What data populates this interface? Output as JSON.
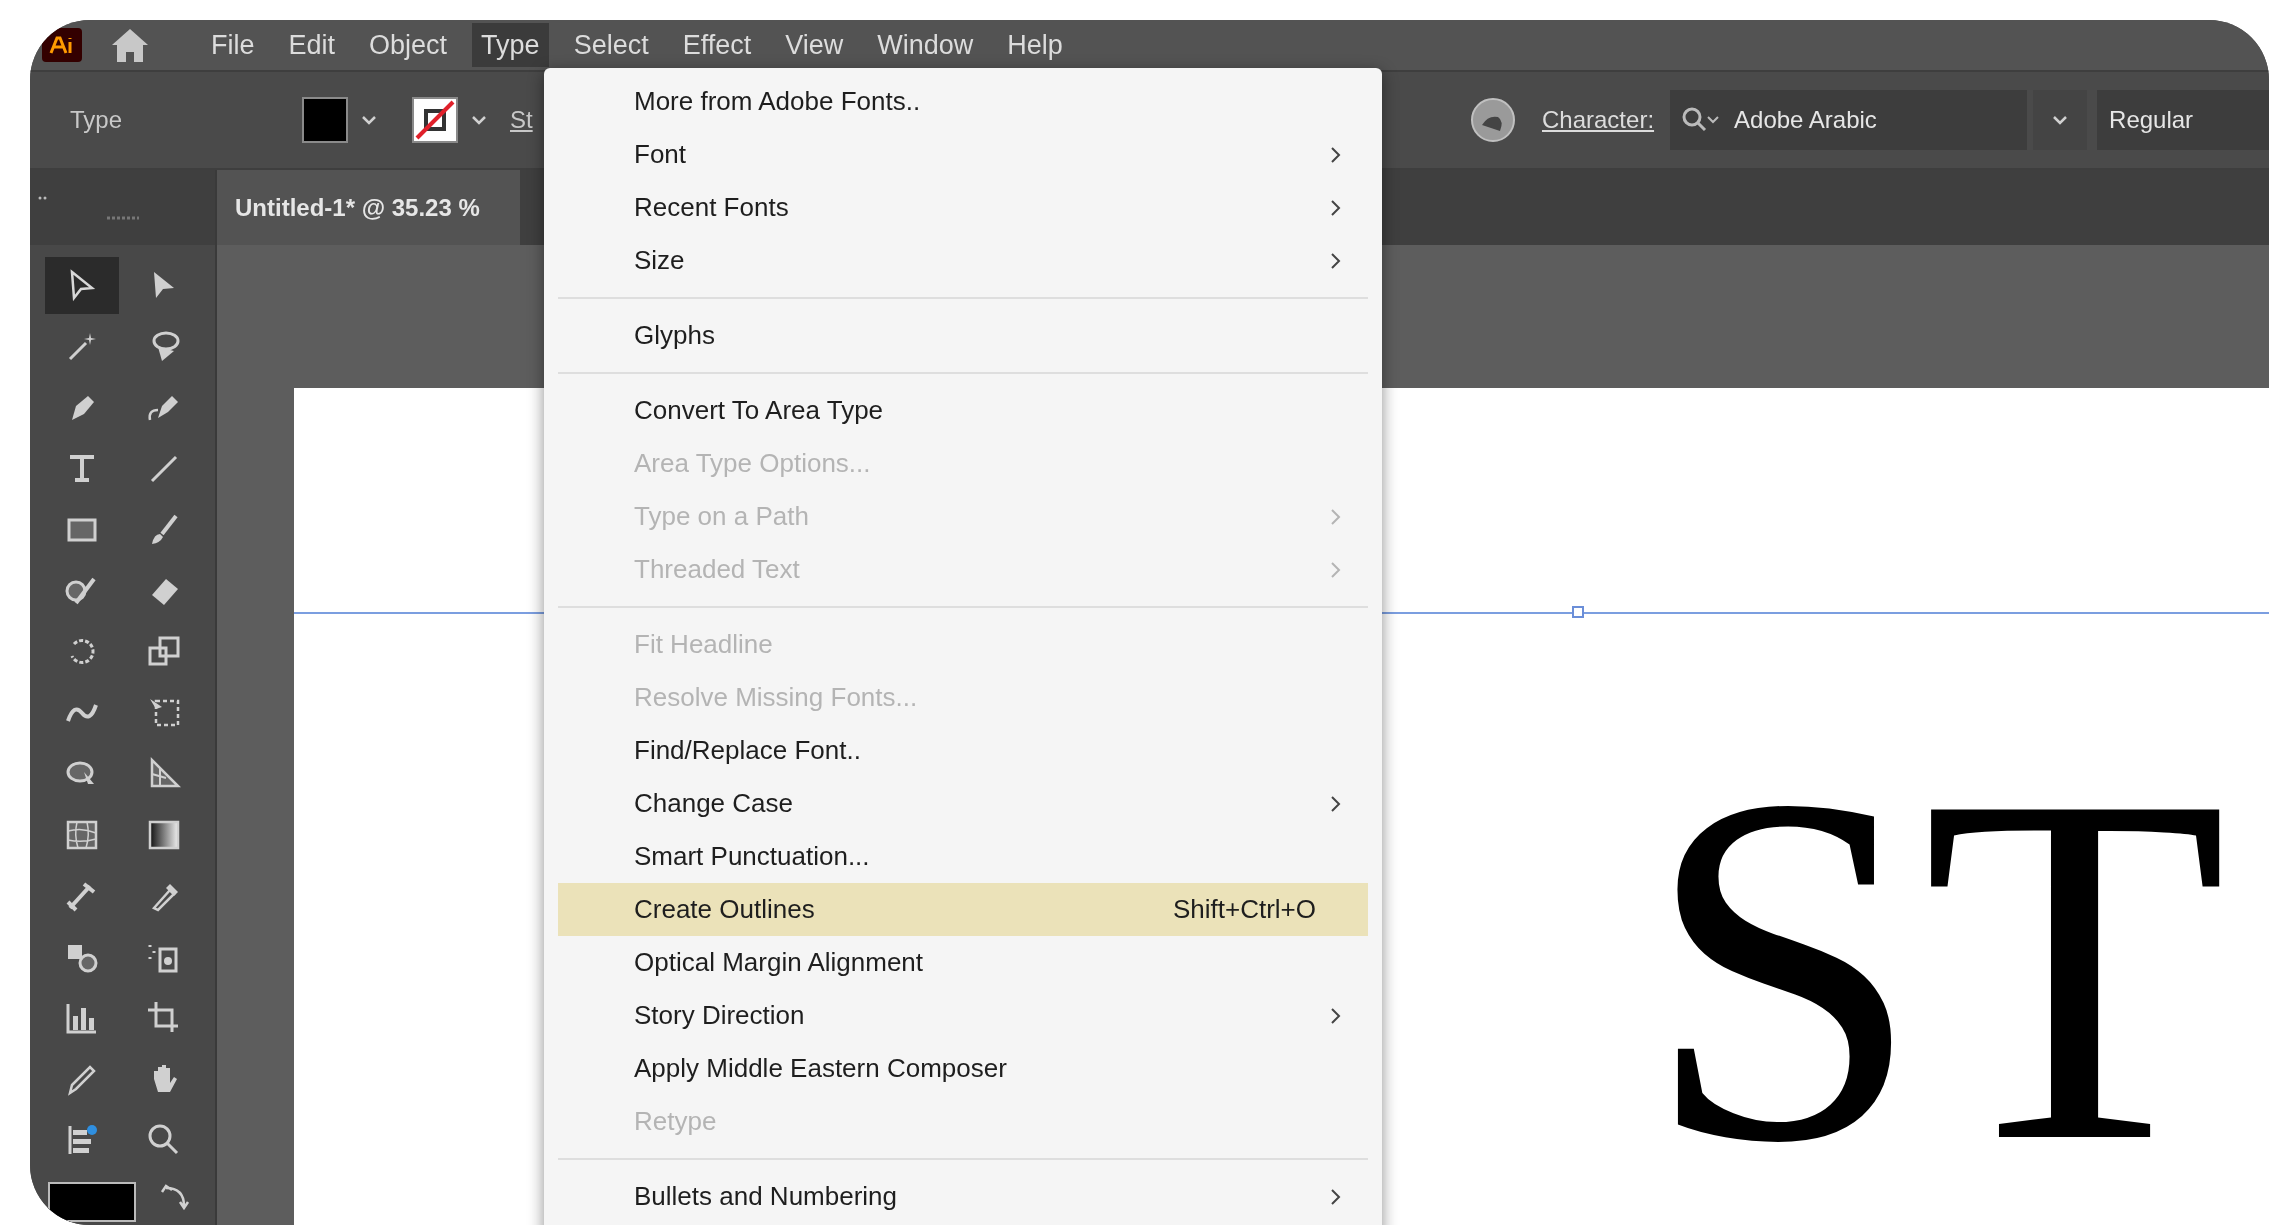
{
  "menu_bar": {
    "items": [
      {
        "label": "File",
        "selected": false
      },
      {
        "label": "Edit",
        "selected": false
      },
      {
        "label": "Object",
        "selected": false
      },
      {
        "label": "Type",
        "selected": true
      },
      {
        "label": "Select",
        "selected": false
      },
      {
        "label": "Effect",
        "selected": false
      },
      {
        "label": "View",
        "selected": false
      },
      {
        "label": "Window",
        "selected": false
      },
      {
        "label": "Help",
        "selected": false
      }
    ]
  },
  "control_bar": {
    "label": "Type",
    "cut_label": "St",
    "character_label": "Character:",
    "font_family": "Adobe Arabic",
    "font_style": "Regular"
  },
  "document_tab": {
    "title": "Untitled-1* @ 35.23 %"
  },
  "tools": [
    {
      "selected": true
    },
    {
      "selected": false
    },
    {
      "selected": false
    },
    {
      "selected": false
    },
    {
      "selected": false
    },
    {
      "selected": false
    },
    {
      "selected": false
    },
    {
      "selected": false
    },
    {
      "selected": false
    },
    {
      "selected": false
    },
    {
      "selected": false
    },
    {
      "selected": false
    },
    {
      "selected": false
    },
    {
      "selected": false
    },
    {
      "selected": false
    },
    {
      "selected": false
    },
    {
      "selected": false
    },
    {
      "selected": false
    },
    {
      "selected": false
    },
    {
      "selected": false
    },
    {
      "selected": false
    },
    {
      "selected": false
    },
    {
      "selected": false
    },
    {
      "selected": false
    },
    {
      "selected": false
    },
    {
      "selected": false
    },
    {
      "selected": false
    },
    {
      "selected": false
    },
    {
      "selected": false
    },
    {
      "selected": false
    }
  ],
  "artboard": {
    "text": "ST"
  },
  "type_menu": {
    "items": [
      {
        "kind": "item",
        "label": "More from Adobe Fonts..",
        "disabled": false,
        "submenu": false,
        "selected": false
      },
      {
        "kind": "item",
        "label": "Font",
        "disabled": false,
        "submenu": true,
        "selected": false
      },
      {
        "kind": "item",
        "label": "Recent Fonts",
        "disabled": false,
        "submenu": true,
        "selected": false
      },
      {
        "kind": "item",
        "label": "Size",
        "disabled": false,
        "submenu": true,
        "selected": false
      },
      {
        "kind": "separator"
      },
      {
        "kind": "item",
        "label": "Glyphs",
        "disabled": false,
        "submenu": false,
        "selected": false
      },
      {
        "kind": "separator"
      },
      {
        "kind": "item",
        "label": "Convert To Area Type",
        "disabled": false,
        "submenu": false,
        "selected": false
      },
      {
        "kind": "item",
        "label": "Area Type Options...",
        "disabled": true,
        "submenu": false,
        "selected": false
      },
      {
        "kind": "item",
        "label": "Type on a Path",
        "disabled": true,
        "submenu": true,
        "selected": false
      },
      {
        "kind": "item",
        "label": "Threaded Text",
        "disabled": true,
        "submenu": true,
        "selected": false
      },
      {
        "kind": "separator"
      },
      {
        "kind": "item",
        "label": "Fit Headline",
        "disabled": true,
        "submenu": false,
        "selected": false
      },
      {
        "kind": "item",
        "label": "Resolve Missing Fonts...",
        "disabled": true,
        "submenu": false,
        "selected": false
      },
      {
        "kind": "item",
        "label": "Find/Replace Font..",
        "disabled": false,
        "submenu": false,
        "selected": false
      },
      {
        "kind": "item",
        "label": "Change Case",
        "disabled": false,
        "submenu": true,
        "selected": false
      },
      {
        "kind": "item",
        "label": "Smart Punctuation...",
        "disabled": false,
        "submenu": false,
        "selected": false
      },
      {
        "kind": "item",
        "label": "Create Outlines",
        "shortcut": "Shift+Ctrl+O",
        "disabled": false,
        "submenu": false,
        "selected": true
      },
      {
        "kind": "item",
        "label": "Optical Margin Alignment",
        "disabled": false,
        "submenu": false,
        "selected": false
      },
      {
        "kind": "item",
        "label": "Story Direction",
        "disabled": false,
        "submenu": true,
        "selected": false
      },
      {
        "kind": "item",
        "label": "Apply Middle Eastern Composer",
        "disabled": false,
        "submenu": false,
        "selected": false
      },
      {
        "kind": "item",
        "label": "Retype",
        "disabled": true,
        "submenu": false,
        "selected": false
      },
      {
        "kind": "separator"
      },
      {
        "kind": "item",
        "label": "Bullets and Numbering",
        "disabled": false,
        "submenu": true,
        "selected": false
      }
    ]
  }
}
